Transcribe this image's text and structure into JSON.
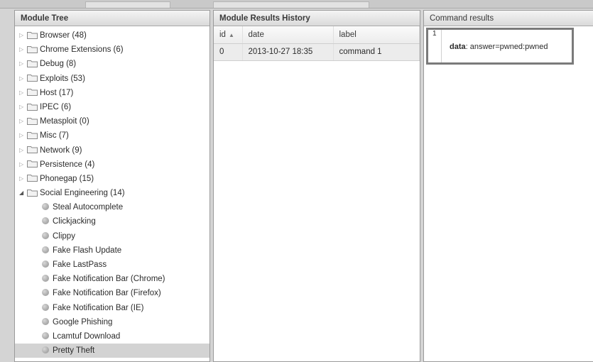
{
  "module_tree": {
    "title": "Module Tree",
    "folders": [
      {
        "label": "Browser (48)"
      },
      {
        "label": "Chrome Extensions (6)"
      },
      {
        "label": "Debug (8)"
      },
      {
        "label": "Exploits (53)"
      },
      {
        "label": "Host (17)"
      },
      {
        "label": "IPEC (6)"
      },
      {
        "label": "Metasploit (0)"
      },
      {
        "label": "Misc (7)"
      },
      {
        "label": "Network (9)"
      },
      {
        "label": "Persistence (4)"
      },
      {
        "label": "Phonegap (15)"
      },
      {
        "label": "Social Engineering (14)",
        "expanded": true
      }
    ],
    "social_engineering_modules": [
      {
        "label": "Steal Autocomplete"
      },
      {
        "label": "Clickjacking"
      },
      {
        "label": "Clippy"
      },
      {
        "label": "Fake Flash Update"
      },
      {
        "label": "Fake LastPass"
      },
      {
        "label": "Fake Notification Bar (Chrome)"
      },
      {
        "label": "Fake Notification Bar (Firefox)"
      },
      {
        "label": "Fake Notification Bar (IE)"
      },
      {
        "label": "Google Phishing"
      },
      {
        "label": "Lcamtuf Download"
      },
      {
        "label": "Pretty Theft",
        "selected": true
      }
    ]
  },
  "results_history": {
    "title": "Module Results History",
    "columns": {
      "id": "id",
      "date": "date",
      "label": "label"
    },
    "rows": [
      {
        "id": "0",
        "date": "2013-10-27 18:35",
        "label": "command 1"
      }
    ]
  },
  "command_results": {
    "title": "Command results",
    "entries": [
      {
        "index": "1",
        "key": "data",
        "value": "answer=pwned:pwned"
      }
    ]
  },
  "colors": {
    "panel_border": "#9a9a9a",
    "selected_row": "#d3d3d3",
    "result_highlight_border": "#7a7a7a"
  }
}
